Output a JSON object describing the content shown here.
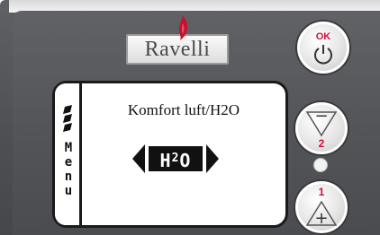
{
  "brand": {
    "logo_text": "Ravelli",
    "accent_color": "#d0103a"
  },
  "display": {
    "menu_letters": [
      "M",
      "e",
      "n",
      "u"
    ],
    "title": "Komfort luft/H2O",
    "mode_label_main": "H",
    "mode_label_sup": "2",
    "mode_label_end": "O",
    "left_arrow_icon": "triangle-left-icon",
    "right_arrow_icon": "triangle-right-icon",
    "menu_icon": "menu-bars-icon"
  },
  "buttons": {
    "ok": {
      "label": "OK",
      "icon": "power-icon"
    },
    "minus": {
      "sign": "−",
      "number": "2"
    },
    "plus": {
      "sign": "+",
      "number": "1"
    }
  }
}
